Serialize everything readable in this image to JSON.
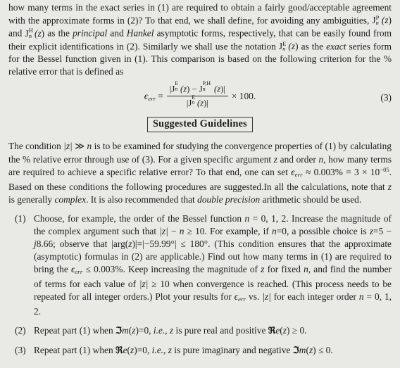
{
  "document": {
    "background_color": "#e9e9e6",
    "text_color": "#1d1d1b",
    "paragraph_1": "how many terms in the exact series in (1) are required to obtain a fairly good/acceptable agreement with the approximate forms in (2)? To that end, we shall define, for avoiding any ambiguities, Jnᴾ(z) and Jnᴴ(z) as the principal and Hankel asymptotic forms, respectively, that can be easily found from their explicit identifications in (2). Similarly we shall use the notation JnᴱE(z) as the exact series form for the Bessel function given in (1). This comparison is based on the following criterion for the % relative error that is defined as",
    "paragraph_2": "The condition |z| ≫ n is to be examined for studying the convergence properties of (1) by calculating the % relative error through use of (3). For a given specific argument z and order n, how many terms are required to achieve a specific relative error? To that end, one can set εerr ≈ 0.003% = 3 × 10⁻⁰⁵. Based on these conditions the following procedures are suggested.In all the calculations, note that z is generally complex. It is also recommended that double precision arithmetic should be used."
  },
  "equation": {
    "number": "(3)",
    "lhs": "ϵerr",
    "equals": "=",
    "numerator": "|Jn^E(z) − Jn^{P,H}(z)|",
    "denominator": "|Jn^E(z)|",
    "times": "×",
    "factor": "100."
  },
  "heading": {
    "text": "Suggested Guidelines"
  },
  "list": {
    "items": [
      {
        "marker": "(1)",
        "text": "Choose, for example, the order of the Bessel function n = 0, 1, 2. Increase the magnitude of the complex argument such that |z| − n ≥ 10. For example, if n = 0, a possible choice is z = 5 − j8.66; observe that |arg(z)| = |−59.99°| ≤ 180°. (This condition ensures that the approximate (asymptotic) formulas in (2) are applicable.) Find out how many terms in (1) are required to bring the ϵerr ≤ 0.003%. Keep increasing the magnitude of z for fixed n, and find the number of terms for each value of |z| ≥ 10 when convergence is reached. (This process needs to be repeated for all integer orders.) Plot your results for ϵerr vs. |z| for each integer order n = 0, 1, 2."
      },
      {
        "marker": "(2)",
        "text": "Repeat part (1) when ℑm(z) = 0, i.e., z is pure real and positive ℜe(z) ≥ 0."
      },
      {
        "marker": "(3)",
        "text": "Repeat part (1) when ℜe(z) = 0, i.e., z is pure imaginary and negative ℑm(z) ≤ 0."
      }
    ]
  },
  "symbols": {
    "bessel": "J",
    "order_subscript": "n",
    "exact_superscript": "E",
    "principal_superscript": "P",
    "hankel_superscript": "H",
    "principal_hankel_superscript": "P,H",
    "epsilon_err": "ϵ",
    "err_subscript": "err",
    "much_greater": "≫",
    "greater_equal": "≥",
    "less_equal": "≤",
    "approx": "≈",
    "times": "×",
    "minus": "−",
    "real_part": "ℜ",
    "imag_part": "ℑ",
    "degree": "°"
  },
  "values": {
    "orders": "0, 1, 2",
    "min_magnitude": "10",
    "example_z": "5 − j8.66",
    "arg_z": "−59.99°",
    "arg_limit": "180°",
    "target_error_percent": "0.003%",
    "target_error_sci": "3 × 10⁻⁰⁵",
    "percent_100": "100",
    "eq_ref_1": "(1)",
    "eq_ref_2": "(2)",
    "eq_ref_3": "(3)"
  }
}
